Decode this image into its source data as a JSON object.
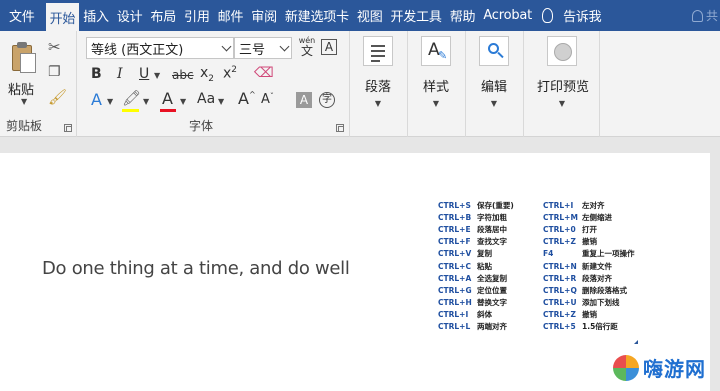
{
  "tabs": [
    {
      "label": "文件",
      "active": false
    },
    {
      "label": "开始",
      "active": true
    },
    {
      "label": "插入",
      "active": false
    },
    {
      "label": "设计",
      "active": false
    },
    {
      "label": "布局",
      "active": false
    },
    {
      "label": "引用",
      "active": false
    },
    {
      "label": "邮件",
      "active": false
    },
    {
      "label": "审阅",
      "active": false
    },
    {
      "label": "新建选项卡",
      "active": false
    },
    {
      "label": "视图",
      "active": false
    },
    {
      "label": "开发工具",
      "active": false
    },
    {
      "label": "帮助",
      "active": false
    },
    {
      "label": "Acrobat",
      "active": false
    }
  ],
  "tell_me": "告诉我",
  "share_label": "共",
  "clipboard": {
    "paste_label": "粘贴",
    "group_label": "剪贴板"
  },
  "font": {
    "font_name": "等线 (西文正文)",
    "font_size": "三号",
    "wen_label": "wén",
    "wen_char": "文",
    "boxed_a": "A",
    "bold": "B",
    "italic": "I",
    "underline": "U",
    "strikethrough": "abc",
    "subscript": "x",
    "superscript": "x",
    "text_effects": "A",
    "font_color": "A",
    "change_case": "Aa",
    "grow_font": "A",
    "shrink_font": "A",
    "char_shading": "A",
    "enclose_char": "字",
    "group_label": "字体",
    "highlight_color": "#ffff00",
    "font_color_value": "#e81123"
  },
  "paragraph": {
    "label": "段落"
  },
  "styles": {
    "label": "样式"
  },
  "editing": {
    "label": "编辑"
  },
  "print_preview": {
    "label": "打印预览"
  },
  "document": {
    "body_text": "Do one thing at a time, and do well",
    "shortcuts_left": [
      {
        "key": "CTRL+S",
        "desc": "保存(重要)"
      },
      {
        "key": "CTRL+B",
        "desc": "字符加粗"
      },
      {
        "key": "CTRL+E",
        "desc": "段落居中"
      },
      {
        "key": "CTRL+F",
        "desc": "查找文字"
      },
      {
        "key": "CTRL+V",
        "desc": "复制"
      },
      {
        "key": "CTRL+C",
        "desc": "粘贴"
      },
      {
        "key": "CTRL+A",
        "desc": "全选复制"
      },
      {
        "key": "CTRL+G",
        "desc": "定位位置"
      },
      {
        "key": "CTRL+H",
        "desc": "替换文字"
      },
      {
        "key": "CTRL+I",
        "desc": "斜体"
      },
      {
        "key": "CTRL+L",
        "desc": "两端对齐"
      }
    ],
    "shortcuts_right": [
      {
        "key": "CTRL+I",
        "desc": "左对齐"
      },
      {
        "key": "CTRL+M",
        "desc": "左侧缩进"
      },
      {
        "key": "CTRL+0",
        "desc": "打开"
      },
      {
        "key": "CTRL+Z",
        "desc": "撤销"
      },
      {
        "key": "F4",
        "desc": "重复上一项操作"
      },
      {
        "key": "CTRL+N",
        "desc": "新建文件"
      },
      {
        "key": "CTRL+R",
        "desc": "段落对齐"
      },
      {
        "key": "CTRL+Q",
        "desc": "删除段落格式"
      },
      {
        "key": "CTRL+U",
        "desc": "添加下划线"
      },
      {
        "key": "CTRL+Z",
        "desc": "撤销"
      },
      {
        "key": "CTRL+5",
        "desc": "1.5倍行距"
      }
    ]
  },
  "watermark": {
    "text": "嗨游网"
  },
  "colors": {
    "ribbon_blue": "#2b579a",
    "shortcut_key_blue": "#1f4fa0"
  }
}
